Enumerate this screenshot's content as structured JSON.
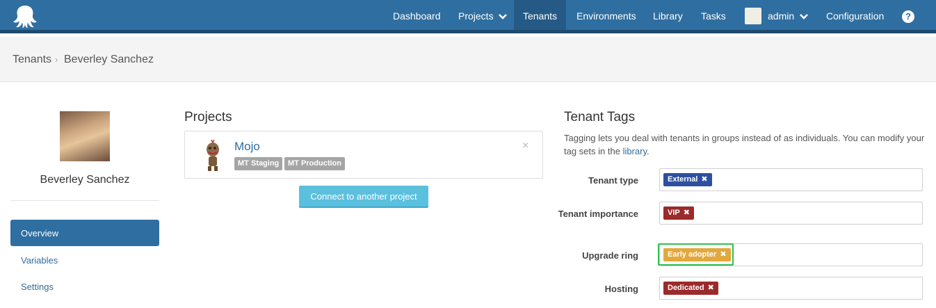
{
  "nav": {
    "items": [
      "Dashboard",
      "Projects",
      "Tenants",
      "Environments",
      "Library",
      "Tasks"
    ],
    "user": "admin",
    "configuration": "Configuration",
    "help_glyph": "?"
  },
  "breadcrumb": {
    "parent": "Tenants",
    "current": "Beverley Sanchez"
  },
  "sidebar": {
    "name": "Beverley Sanchez",
    "items": [
      "Overview",
      "Variables",
      "Settings"
    ],
    "active": "Overview"
  },
  "projects": {
    "title": "Projects",
    "list": [
      {
        "name": "Mojo",
        "environments": [
          "MT Staging",
          "MT Production"
        ],
        "remove": "×"
      }
    ],
    "connect_button": "Connect to another project"
  },
  "tags": {
    "title": "Tenant Tags",
    "description": "Tagging lets you deal with tenants in groups instead of as individuals. You can modify your tag sets in the",
    "link": "library",
    "description_end": ".",
    "sets": [
      {
        "label": "Tenant type",
        "tag": "External",
        "color": "#2d4f9f"
      },
      {
        "label": "Tenant importance",
        "tag": "VIP",
        "color": "#9b2a2a"
      },
      {
        "label": "Upgrade ring",
        "tag": "Early adopter",
        "color": "#e3a83c"
      },
      {
        "label": "Hosting",
        "tag": "Dedicated",
        "color": "#9b2a2a"
      }
    ],
    "remove_glyph": "✖"
  },
  "colors": {
    "nav_bg": "#2f6ea0",
    "accent": "#2f6ea0",
    "button": "#5bc0de"
  }
}
